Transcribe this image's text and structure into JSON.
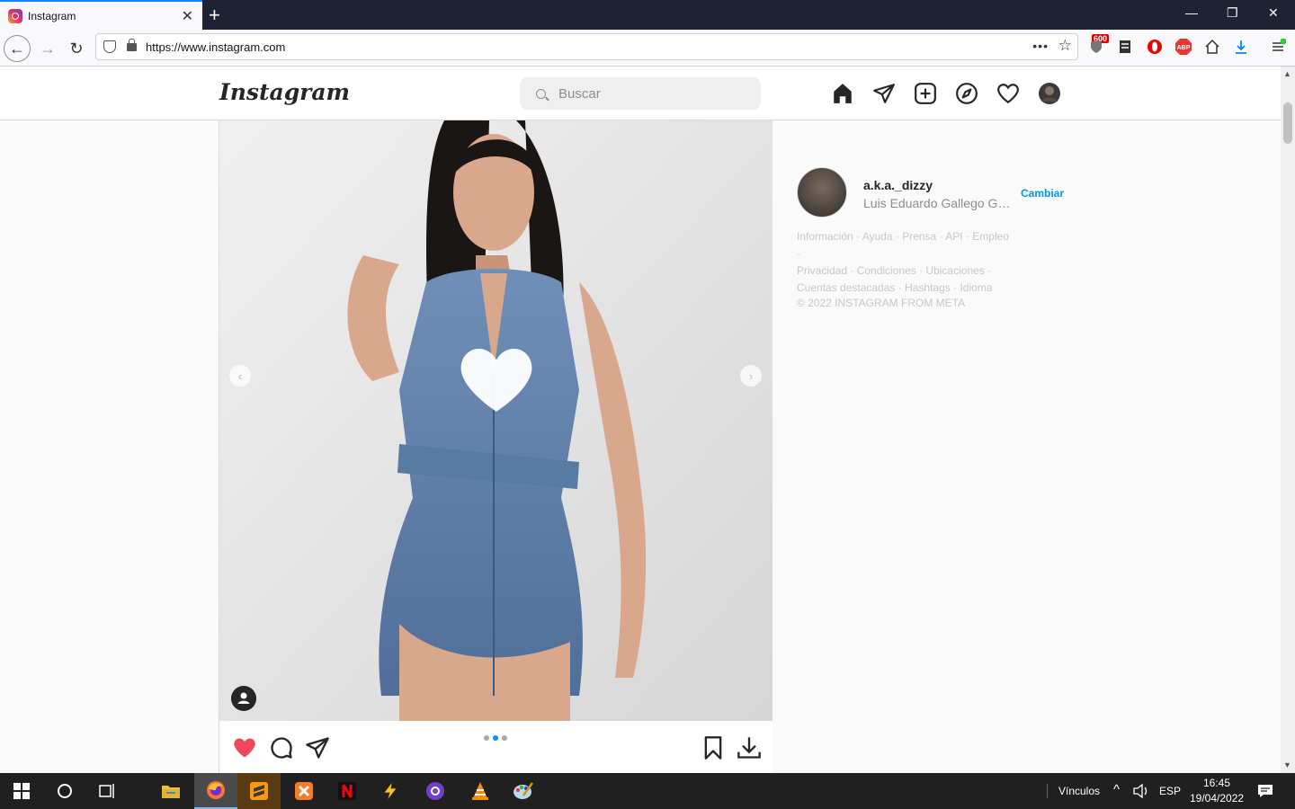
{
  "browser": {
    "tab_title": "Instagram",
    "url": "https://www.instagram.com",
    "badge_count": "600",
    "abp_label": "ABP"
  },
  "instagram": {
    "logo": "Instagram",
    "search_placeholder": "Buscar",
    "nav_icons": [
      "home-icon",
      "direct-icon",
      "new-post-icon",
      "explore-icon",
      "activity-icon",
      "profile-avatar"
    ]
  },
  "post": {
    "carousel_total": 3,
    "carousel_active": 2,
    "liked": true
  },
  "sidebar": {
    "username": "a.k.a._dizzy",
    "full_name": "Luis Eduardo Gallego Gar...",
    "switch_label": "Cambiar",
    "footer_links": [
      "Información",
      "Ayuda",
      "Prensa",
      "API",
      "Empleo",
      "Privacidad",
      "Condiciones",
      "Ubicaciones",
      "Cuentas destacadas",
      "Hashtags",
      "Idioma"
    ],
    "copyright": "© 2022 INSTAGRAM FROM META"
  },
  "taskbar": {
    "links_label": "Vínculos",
    "language": "ESP",
    "time": "16:45",
    "date": "19/04/2022"
  },
  "colors": {
    "accent_blue": "#0095f6",
    "like_red": "#ed4956",
    "taskbar_bg": "#202020",
    "tabbar_bg": "#1f2235"
  }
}
